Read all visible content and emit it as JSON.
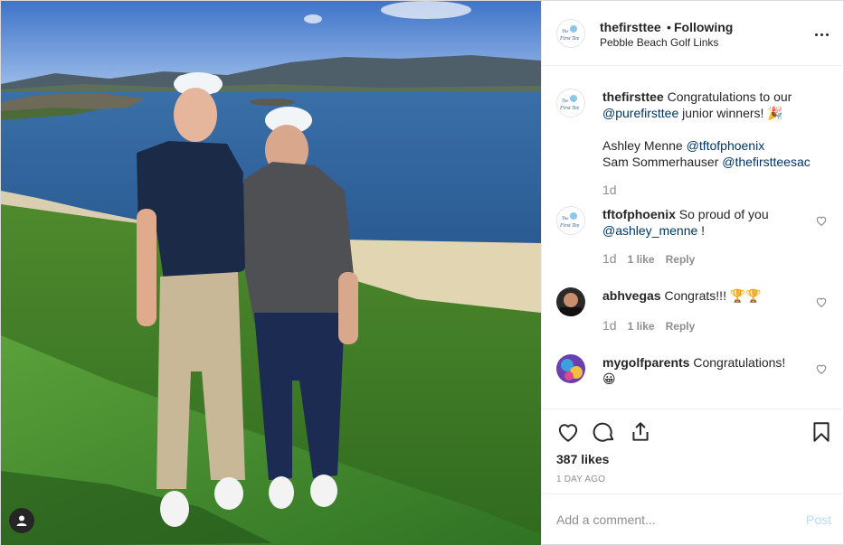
{
  "post": {
    "username": "thefirsttee",
    "separator": "•",
    "follow_status": "Following",
    "location": "Pebble Beach Golf Links",
    "logo_text_top": "The",
    "logo_text_main": "First Tee"
  },
  "caption": {
    "username": "thefirsttee",
    "text_1": " Congratulations to our ",
    "mention_1": "@purefirsttee",
    "text_2": " junior winners! ",
    "emoji": "🎉",
    "line_2_name": "Ashley Menne ",
    "mention_2": "@tftofphoenix",
    "line_3_name": "Sam Sommerhauser ",
    "mention_3": "@thefirstteesac",
    "time": "1d"
  },
  "comments": [
    {
      "username": "tftofphoenix",
      "text": " So proud of you ",
      "mention": "@ashley_menne",
      "text_after": " !",
      "time": "1d",
      "likes": "1 like",
      "reply": "Reply"
    },
    {
      "username": "abhvegas",
      "text": " Congrats!!! ",
      "emoji": "🏆🏆",
      "time": "1d",
      "likes": "1 like",
      "reply": "Reply"
    },
    {
      "username": "mygolfparents",
      "text": " Congratulations! ",
      "emoji": "😀"
    }
  ],
  "actions": {
    "likes": "387 likes",
    "time": "1 DAY AGO"
  },
  "add_comment": {
    "placeholder": "Add a comment...",
    "post_label": "Post"
  },
  "colors": {
    "mention": "#003569",
    "post_disabled": "#b3dbff",
    "muted": "#8e8e8e"
  }
}
